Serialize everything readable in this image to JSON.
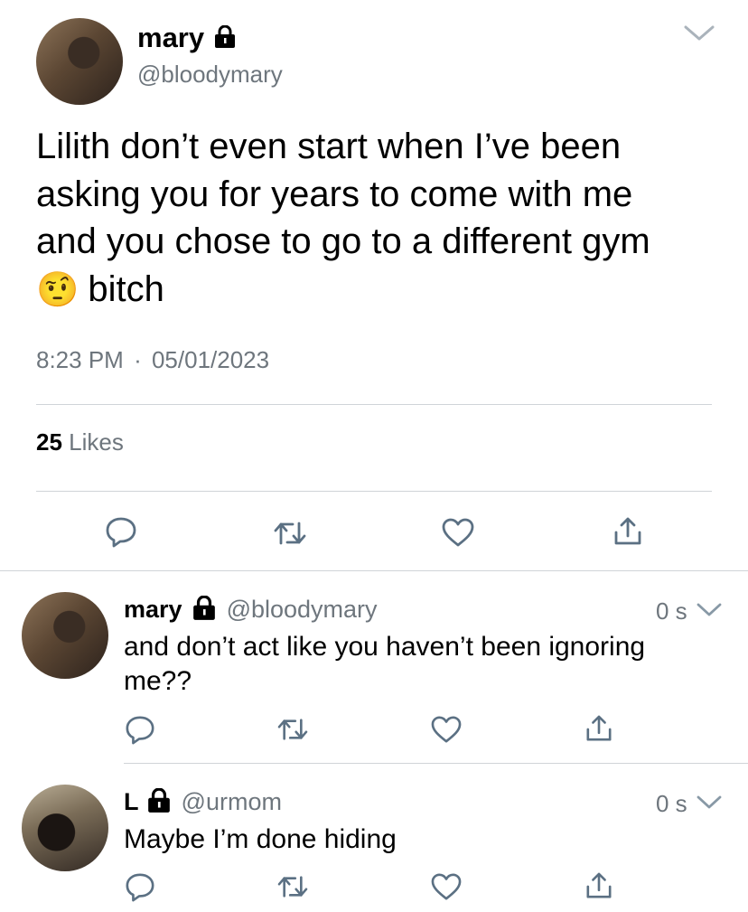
{
  "main_tweet": {
    "display_name": "mary",
    "handle": "@bloodymary",
    "text_line1": "Lilith don’t even start when I’ve been",
    "text_line2": "asking you for years to come with me",
    "text_line3": "and you chose to go to a different gym",
    "text_line4": "bitch",
    "emoji": "🤨",
    "time": "8:23 PM",
    "separator": "·",
    "date": "05/01/2023",
    "likes_count": "25",
    "likes_label": "Likes"
  },
  "replies": [
    {
      "display_name": "mary",
      "handle": "@bloodymary",
      "time": "0 s",
      "text_line1": "and don’t act like you haven’t been ignoring",
      "text_line2": "me??"
    },
    {
      "display_name": "L",
      "handle": "@urmom",
      "time": "0 s",
      "text_line1": "Maybe I’m done hiding"
    }
  ],
  "icons": {
    "reply": "reply-icon",
    "retweet": "retweet-icon",
    "like": "heart-icon",
    "share": "share-icon",
    "lock": "lock-icon",
    "caret": "chevron-down-icon"
  },
  "colors": {
    "text": "#000000",
    "secondary": "#6e767d",
    "icon": "#5b7083",
    "divider": "#d0d4d8"
  }
}
